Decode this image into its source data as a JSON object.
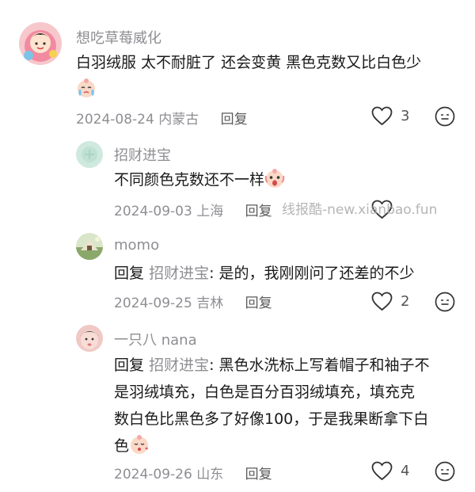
{
  "comments": [
    {
      "user": "想吃草莓威化",
      "text": "白羽绒服 太不耐脏了 还会变黄 黑色克数又比白色少",
      "emoji": "tearful-face-emoji",
      "date": "2024-08-24",
      "location": "内蒙古",
      "reply_label": "回复",
      "likes": "3",
      "avatar_color": "#f3c3c7"
    },
    {
      "user": "招财进宝",
      "text": "不同颜色克数还不一样",
      "emoji": "screaming-face-emoji",
      "date": "2024-09-03",
      "location": "上海",
      "reply_label": "回复",
      "likes": "",
      "avatar_color": "#cfe9df"
    },
    {
      "user": "momo",
      "reply_prefix": "回复",
      "reply_target": "招财进宝",
      "text": ": 是的，我刚刚问了还差的不少",
      "date": "2024-09-25",
      "location": "吉林",
      "reply_label": "回复",
      "likes": "2",
      "avatar_color": "#9fb88a"
    },
    {
      "user": "一只八 nana",
      "reply_prefix": "回复",
      "reply_target": "招财进宝",
      "text_lines": [
        ": 黑色水洗标上写着帽子和袖子不",
        "是羽绒填充，白色是百分百羽绒填充，填充克",
        "数白色比黑色多了好像100，于是我果断拿下白",
        "色"
      ],
      "emoji": "kissing-face-emoji",
      "date": "2024-09-26",
      "location": "山东",
      "reply_label": "回复",
      "likes": "4",
      "avatar_color": "#f0c9c4"
    }
  ],
  "watermark": "线报酷-new.xianbao.fun",
  "icons": {
    "like": "heart-outline-icon",
    "more": "more-options-icon"
  }
}
